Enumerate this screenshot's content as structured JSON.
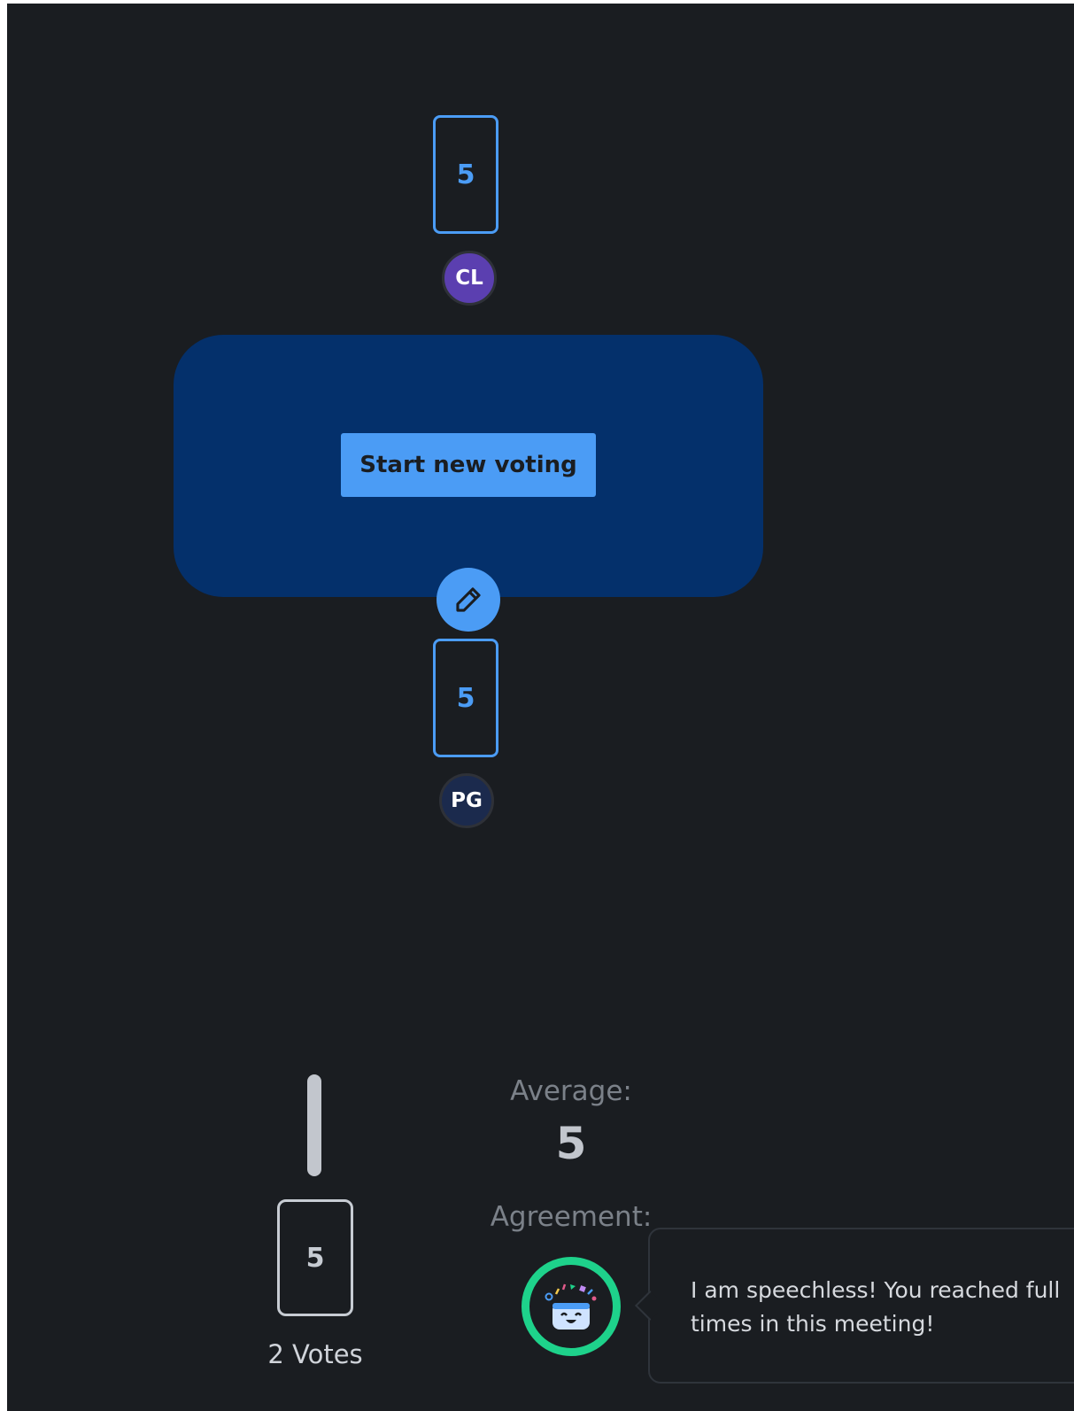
{
  "players": [
    {
      "card_value": "5",
      "initials": "CL",
      "avatar_color": "#5b3fb0"
    },
    {
      "card_value": "5",
      "initials": "PG",
      "avatar_color": "#1b2a4d"
    }
  ],
  "table": {
    "start_button_label": "Start new voting",
    "edit_icon": "pencil-icon"
  },
  "results": {
    "card_value": "5",
    "votes_label": "2 Votes",
    "average_label": "Average:",
    "average_value": "5",
    "agreement_label": "Agreement:",
    "agreement_icon": "party-face-icon",
    "agreement_fraction": 1.0,
    "agreement_message": "I am speechless! You reached full\ntimes in this meeting!"
  },
  "colors": {
    "accent": "#4b9cf5",
    "background": "#1a1d21",
    "table": "#04306b",
    "agreement_ring": "#1ed28b"
  }
}
